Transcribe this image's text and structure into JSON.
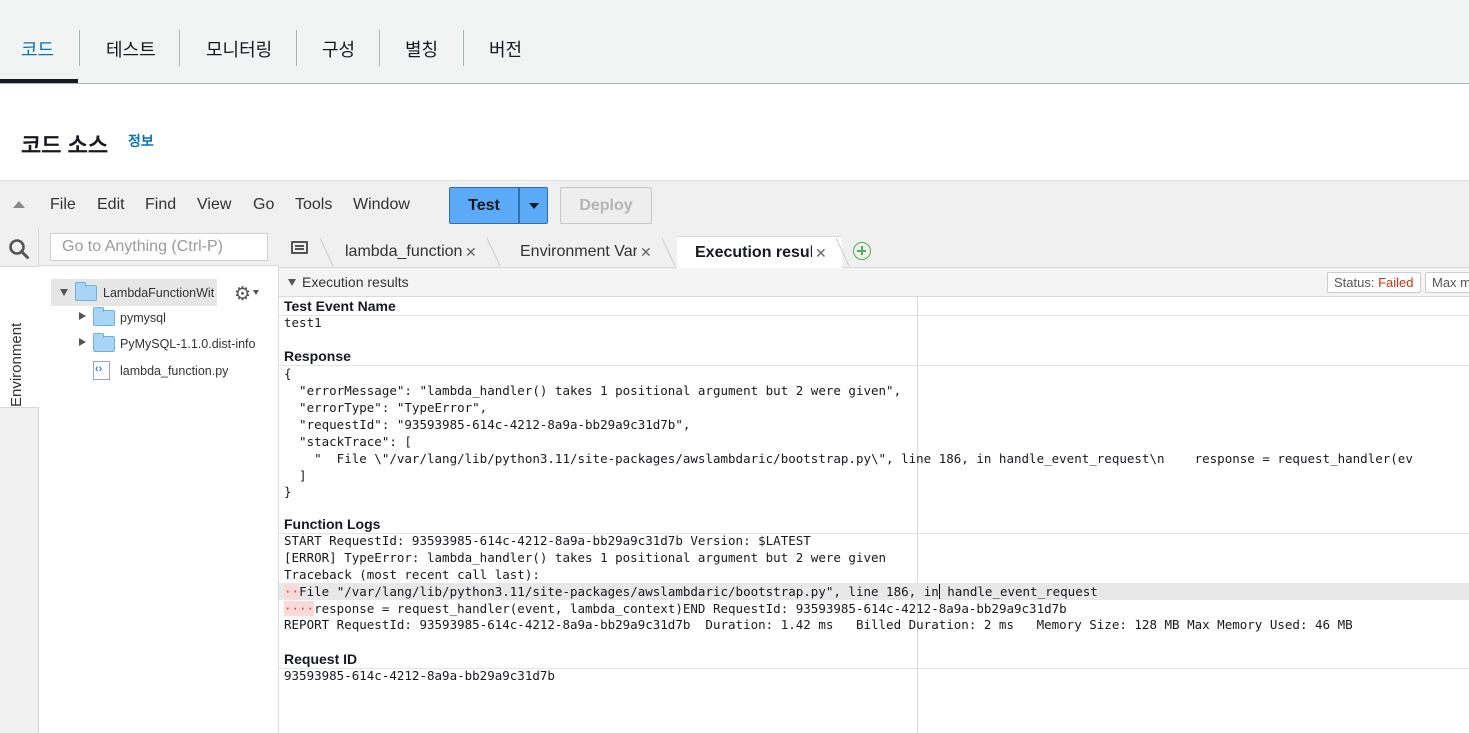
{
  "top_tabs": [
    "코드",
    "테스트",
    "모니터링",
    "구성",
    "별칭",
    "버전"
  ],
  "section": {
    "title": "코드 소스",
    "info_link": "정보"
  },
  "menubar": {
    "items": [
      "File",
      "Edit",
      "Find",
      "View",
      "Go",
      "Tools",
      "Window"
    ],
    "test_label": "Test",
    "deploy_label": "Deploy"
  },
  "sidebar": {
    "environment_label": "Environment",
    "search_placeholder": "Go to Anything (Ctrl-P)",
    "tree": {
      "root": "LambdaFunctionWit",
      "children": [
        "pymysql",
        "PyMySQL-1.1.0.dist-info",
        "lambda_function.py"
      ]
    }
  },
  "editor_tabs": [
    "lambda_function",
    "Environment Vari",
    "Execution results"
  ],
  "results": {
    "header": "Execution results",
    "status_label": "Status:",
    "status_value": "Failed",
    "max_memory_label": "Max m",
    "test_event_label": "Test Event Name",
    "test_event_value": "test1",
    "response_label": "Response",
    "response_lines": [
      "{",
      "  \"errorMessage\": \"lambda_handler() takes 1 positional argument but 2 were given\",",
      "  \"errorType\": \"TypeError\",",
      "  \"requestId\": \"93593985-614c-4212-8a9a-bb29a9c31d7b\",",
      "  \"stackTrace\": [",
      "    \"  File \\\"/var/lang/lib/python3.11/site-packages/awslambdaric/bootstrap.py\\\", line 186, in handle_event_request\\n    response = request_handler(ev",
      "  ]",
      "}"
    ],
    "logs_label": "Function Logs",
    "log_line1": "START RequestId: 93593985-614c-4212-8a9a-bb29a9c31d7b Version: $LATEST",
    "log_line2": "[ERROR] TypeError: lambda_handler() takes 1 positional argument but 2 were given",
    "log_line3": "Traceback (most recent call last):",
    "log_line4_marks": "··",
    "log_line4_a": "File \"/var/lang/lib/python3.11/site-packages/awslambdaric/bootstrap.py\", line 186, in",
    "log_line4_b": " handle_event_request",
    "log_line5_marks": "····",
    "log_line5": "response = request_handler(event, lambda_context)END RequestId: 93593985-614c-4212-8a9a-bb29a9c31d7b",
    "log_line6": "REPORT RequestId: 93593985-614c-4212-8a9a-bb29a9c31d7b  Duration: 1.42 ms   Billed Duration: 2 ms   Memory Size: 128 MB Max Memory Used: 46 MB",
    "request_id_label": "Request ID",
    "request_id_value": "93593985-614c-4212-8a9a-bb29a9c31d7b"
  },
  "colors": {
    "accent": "#0073bb",
    "test_button": "#5aaaf8",
    "failed": "#d13212"
  }
}
